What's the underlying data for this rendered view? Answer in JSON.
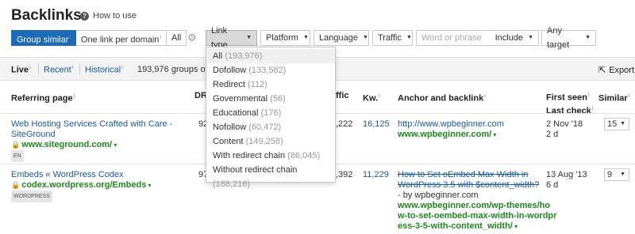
{
  "header": {
    "title": "Backlinks",
    "title_sup": "i",
    "howto": "How to use",
    "howto_icon": "?"
  },
  "toolbar": {
    "group_similar": "Group similar",
    "one_link": "One link per domain",
    "all": "All",
    "link_type": "Link type",
    "platform": "Platform",
    "language": "Language",
    "traffic": "Traffic",
    "word_placeholder": "Word or phrase",
    "include": "Include",
    "any_target": "Any target"
  },
  "tabs": {
    "live": "Live",
    "recent": "Recent",
    "historical": "Historical",
    "groups_text": "193,976 groups of s",
    "export": "Export"
  },
  "columns": {
    "referring_page": "Referring page",
    "dr": "DR",
    "traffic": "ffic",
    "kw": "Kw.",
    "anchor": "Anchor and backlink",
    "first_seen": "First seen",
    "last_check": "Last check",
    "similar": "Similar"
  },
  "rows": [
    {
      "title1": "Web Hosting Services Crafted with Care -",
      "title2": "SiteGround",
      "url": "www.siteground.com/",
      "badge": "EN",
      "dr": "92",
      "traffic": ",222",
      "kw": "16,125",
      "anchor_link": "http://www.wpbeginner.com",
      "anchor_domain": "www.wpbeginner.com/",
      "first_seen": "2 Nov '18",
      "last_check": "2 d",
      "similar": "15"
    },
    {
      "title1": "Embeds « WordPress Codex",
      "url": "codex.wordpress.org/Embeds",
      "badge": "WORDPRESS",
      "dr": "97",
      "traffic": ",392",
      "kw": "11,229",
      "anchor_strike1": "How to Set oEmbed Max Width in",
      "anchor_strike2": "WordPress 3.5 with $content_width?",
      "anchor_by": "- by wpbeginner.com",
      "anchor_url1": "www.wpbeginner.com/wp-themes/ho",
      "anchor_url2": "w-to-set-oembed-max-width-in-wordpr",
      "anchor_url3": "ess-3-5-with-content_width/",
      "first_seen": "13 Aug '13",
      "last_check": "6 d",
      "similar": "9"
    }
  ],
  "link_type_menu": [
    {
      "label": "All",
      "count": "(193,976)"
    },
    {
      "label": "Dofollow",
      "count": "(133,582)"
    },
    {
      "label": "Redirect",
      "count": "(112)"
    },
    {
      "label": "Governmental",
      "count": "(56)"
    },
    {
      "label": "Educational",
      "count": "(176)"
    },
    {
      "label": "Nofollow",
      "count": "(60,472)"
    },
    {
      "label": "Content",
      "count": "(149,258)"
    },
    {
      "label": "With redirect chain",
      "count": "(86,045)"
    },
    {
      "label": "Without redirect chain",
      "count": "(188,216)"
    }
  ],
  "colors": {
    "accent": "#1c6ab8",
    "link": "#1a5aa8",
    "green": "#1a8a1a"
  }
}
